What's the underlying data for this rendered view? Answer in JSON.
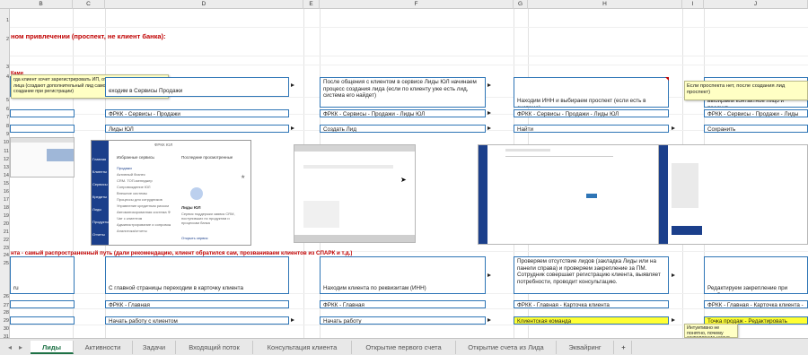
{
  "columns": [
    "B",
    "C",
    "D",
    "E",
    "F",
    "G",
    "H",
    "I",
    "J"
  ],
  "rows": [
    "1",
    "2",
    "3",
    "4",
    "5",
    "6",
    "7",
    "8",
    "9",
    "10",
    "11",
    "12",
    "13",
    "14",
    "15",
    "16",
    "17",
    "18",
    "19",
    "20",
    "21",
    "22",
    "23",
    "24",
    "25",
    "26",
    "27",
    "28",
    "29",
    "30",
    "31"
  ],
  "header": {
    "title": "ном привлечении (проспект, не клиент банка):"
  },
  "row4_label": "Ками",
  "row4_desc": "гда клиент хочет зарегистрировать ИП, отсутствует карточка ИП, его лица (создают дополнительный лид самостоятельно, чтобы ическое создание при регистрации)",
  "steps_top": {
    "d_intro": "еходим в Сервисы Продажи",
    "f_intro": "После общения с клиентом в сервисе Лиды ЮЛ начинаем процесс создания лида (если по клиенту уже есть лид, система его найдет)",
    "h_intro": "Находим ИНН и выбираем проспект (если есть в системе)",
    "j_intro": "выбираем контактное лицо и продукт",
    "d_path": "ФРКК - Сервисы - Продажи",
    "f_path": "ФРКК - Сервисы - Продажи - Лиды ЮЛ",
    "h_path": "ФРКК - Сервисы - Продажи - Лиды ЮЛ",
    "j_path": "ФРКК - Сервисы - Продажи - Лиды ЮЛ",
    "d_action": "Лиды ЮЛ",
    "f_action": "Создать Лид",
    "h_action": "Найти",
    "j_action": "Сохранить"
  },
  "note_j": "Если проспекта нет, после создания лид проспект)",
  "popup": {
    "title": "Избранные сервисы",
    "header_center": "ФРКК  ЮЛ",
    "recent": "Последние просмотренные",
    "nav": [
      "Продажи",
      "Активный бизнес",
      "CRM. ТОП-менеджер",
      "Сопровождение ЮЛ",
      "Внешние системы",
      "Процессы для сотрудников",
      "Управление кредитным риском",
      "Автоматизированная система ФРКК",
      "Чат с клиентом",
      "Администрирование и сопровождение",
      "Аналитика/отчеты"
    ],
    "side": [
      "Главная",
      "Клиенты",
      "Сервисы",
      "Кредиты",
      "Лиды",
      "Продукты",
      "Отчеты"
    ],
    "service_name": "Лиды ЮЛ",
    "service_desc": "Сервис поддержки заявок CRM, поступивших по продуктам и процессам банка",
    "footer": "Открыть сервис"
  },
  "section2_title": "нта - самый распространенный путь (дали рекомендацию, клиент обратился сам, прозваниваем клиентов из СПАРК и т.д.)",
  "steps_bottom": {
    "b_text": "ru",
    "d_text": "С главной страницы переходим в карточку клиента",
    "f_text": "Находим клиента по реквизитам (ИНН)",
    "h_text": "Проверяем отсутствие лидов (закладка Лиды или на панели справа) и проверяем закрепление за ПМ. Сотрудник совершает регистрацию клиента, выявляет потребности, проводит консультацию.",
    "j_text": "Редактируем закрепление при необход",
    "d_path": "ФРКК - Главная",
    "f_path": "ФРКК - Главная",
    "h_path": "ФРКК - Главная - Карточка клиента",
    "j_path": "ФРКК - Главная - Карточка клиента - Главн",
    "d_action": "Начать работу с клиентом",
    "f_action": "Начать работу",
    "h_action": "Клиентская команда",
    "j_action": "Точка продаж - Редактировать"
  },
  "note_bottom": "Интуитивно не понятно, почему закрепление нужно",
  "tabs": [
    "Лиды",
    "Активности",
    "Задачи",
    "Входящий поток",
    "Консультация клиента",
    "Открытие первого счета",
    "Открытие счета из Лида",
    "Эквайринг",
    "+"
  ],
  "colors": {
    "box_border": "#2e75b6",
    "highlight": "#ffff33",
    "title_red": "#c00000",
    "tab_active": "#1e7145",
    "sidebar": "#1b3f8b"
  }
}
